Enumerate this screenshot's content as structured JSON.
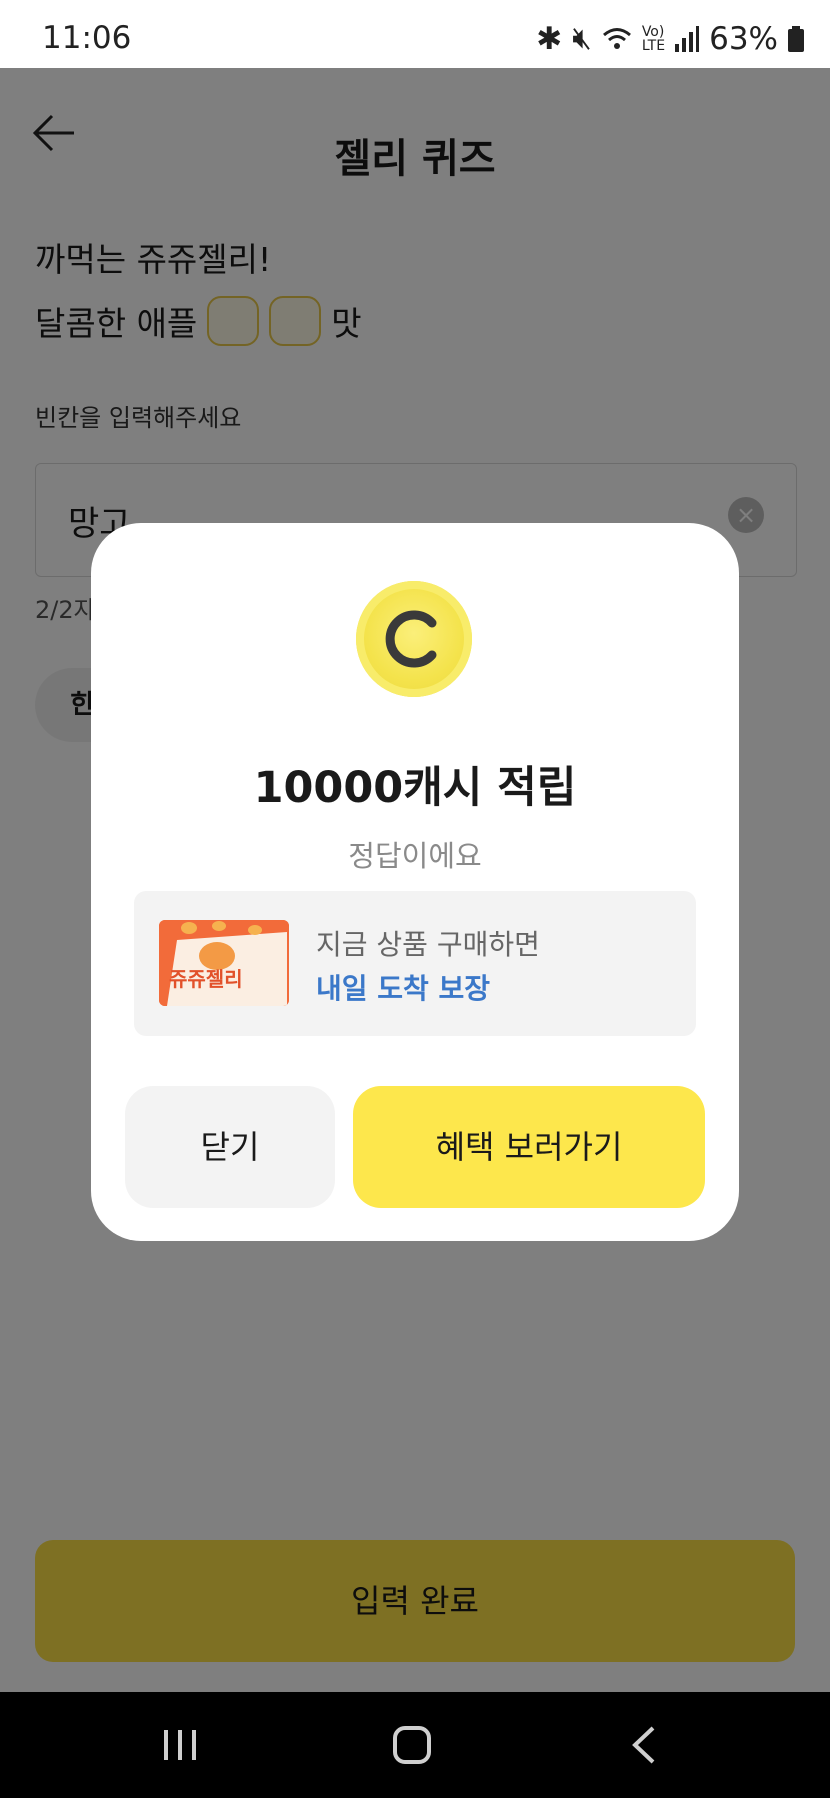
{
  "status_bar": {
    "time": "11:06",
    "battery": "63%",
    "icons": [
      "talk-icon",
      "talk-icon",
      "app-icon",
      "bluetooth-icon",
      "mute-icon",
      "wifi-icon",
      "volte-icon",
      "signal-icon",
      "battery-icon"
    ]
  },
  "header": {
    "title": "젤리 퀴즈",
    "back_icon": "arrow-left-icon"
  },
  "quiz": {
    "line1": "까먹는 쥬쥬젤리!",
    "line2_prefix": "달콤한 애플",
    "line2_suffix": "맛",
    "input_label": "빈칸을 입력해주세요",
    "input_value": "망고",
    "char_count": "2/2자",
    "hint_button": "힌트"
  },
  "submit_button": "입력 완료",
  "modal": {
    "coin_letter": "C",
    "title": "10000캐시 적립",
    "subtitle": "정답이에요",
    "promo_line1": "지금 상품 구매하면",
    "promo_line2": "내일 도착 보장",
    "promo_image_text": "쥬쥬젤리",
    "close_button": "닫기",
    "benefit_button": "혜택 보러가기"
  },
  "colors": {
    "accent_yellow": "#fde047",
    "promo_blue": "#3b78c9",
    "overlay": "rgba(0,0,0,0.5)"
  }
}
